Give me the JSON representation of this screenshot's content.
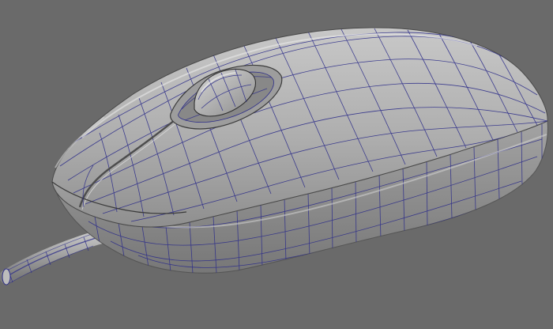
{
  "viewport": {
    "background_color": "#6a6a6a",
    "shading": "smooth-shaded-with-wireframe-on-shaded",
    "wire_color": "#2f2f8a"
  },
  "model": {
    "subject": "computer mouse",
    "parts": [
      "mouse-shell",
      "scroll-wheel",
      "button-split",
      "base-band",
      "cable"
    ],
    "surface_color": "#a7a7a7",
    "highlight_color": "#cfcfcf",
    "shadow_color": "#7c7c7c"
  }
}
